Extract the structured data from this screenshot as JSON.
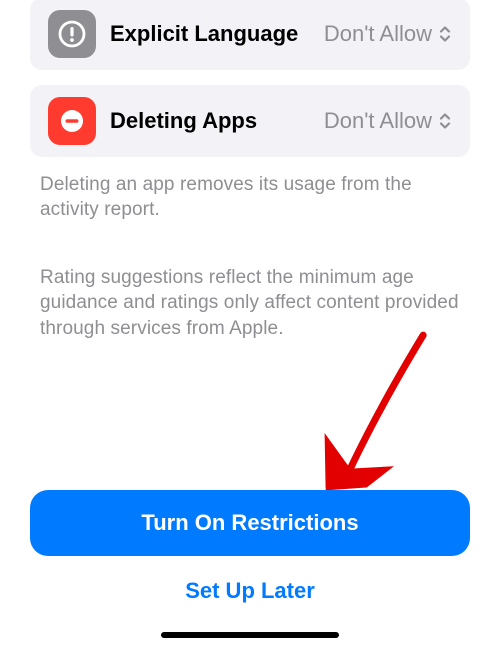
{
  "settings": [
    {
      "title": "Explicit Language",
      "value": "Don't Allow",
      "icon": "exclamation-icon",
      "iconColor": "#8e8e93"
    },
    {
      "title": "Deleting Apps",
      "value": "Don't Allow",
      "icon": "minus-circle-icon",
      "iconColor": "#ff3b30"
    }
  ],
  "captions": {
    "deleting": "Deleting an app removes its usage from the activity report.",
    "rating": "Rating suggestions reflect the minimum age guidance and ratings only affect content provided through services from Apple."
  },
  "buttons": {
    "primary": "Turn On Restrictions",
    "secondary": "Set Up Later"
  }
}
